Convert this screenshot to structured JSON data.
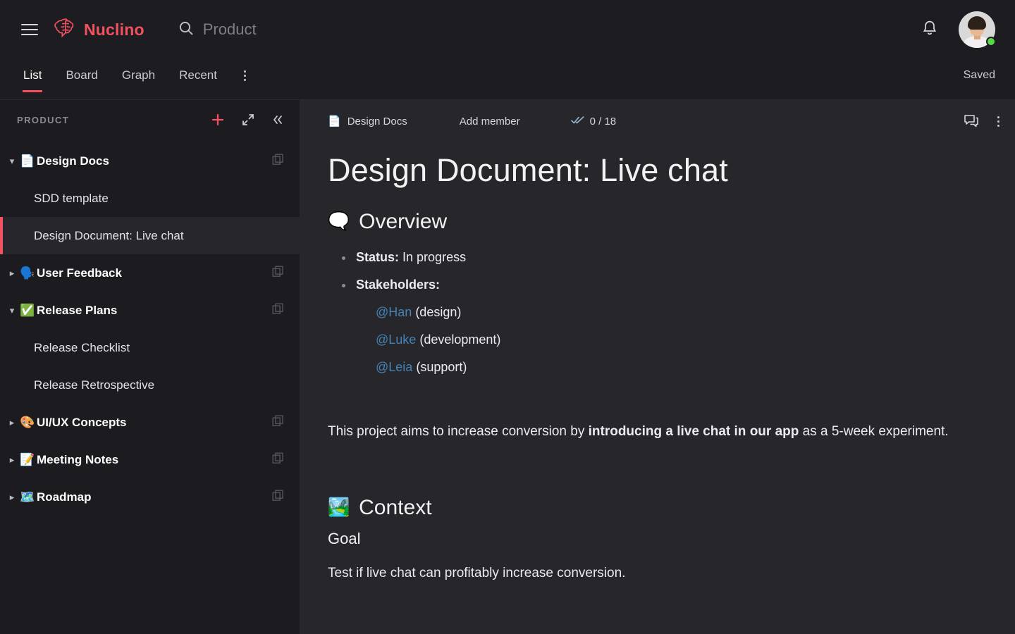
{
  "header": {
    "menu_icon": "hamburger-icon",
    "brand": "Nuclino",
    "brand_icon": "brain-speech-bubble-icon",
    "brand_color": "#f0525f",
    "search_icon": "search-icon",
    "search_value": "",
    "search_placeholder": "Product",
    "notifications_icon": "bell-icon",
    "avatar_icon": "user-avatar",
    "status": "online"
  },
  "tabbar": {
    "tabs": [
      {
        "label": "List",
        "active": true
      },
      {
        "label": "Board",
        "active": false
      },
      {
        "label": "Graph",
        "active": false
      },
      {
        "label": "Recent",
        "active": false
      }
    ],
    "more_icon": "vertical-dots-icon",
    "save_status": "Saved",
    "active_color": "#f0525f"
  },
  "sidebar": {
    "title": "PRODUCT",
    "actions": [
      {
        "name": "add-item-button",
        "icon": "plus-icon"
      },
      {
        "name": "expand-button",
        "icon": "expand-icon"
      },
      {
        "name": "collapse-sidebar-button",
        "icon": "double-chevron-left-icon"
      }
    ],
    "tree": [
      {
        "type": "cluster",
        "label": "Design Docs",
        "emoji": "📄",
        "expanded": true,
        "copy": true
      },
      {
        "type": "item",
        "label": "SDD template",
        "selected": false
      },
      {
        "type": "item",
        "label": "Design Document: Live chat",
        "selected": true
      },
      {
        "type": "cluster",
        "label": "User Feedback",
        "emoji": "🗣️",
        "expanded": false,
        "copy": true
      },
      {
        "type": "cluster",
        "label": "Release Plans",
        "emoji": "✅",
        "expanded": true,
        "copy": true
      },
      {
        "type": "item",
        "label": "Release Checklist",
        "selected": false
      },
      {
        "type": "item",
        "label": "Release Retrospective",
        "selected": false
      },
      {
        "type": "cluster",
        "label": "UI/UX Concepts",
        "emoji": "🎨",
        "expanded": false,
        "copy": true
      },
      {
        "type": "cluster",
        "label": "Meeting Notes",
        "emoji": "📝",
        "expanded": false,
        "copy": true
      },
      {
        "type": "cluster",
        "label": "Roadmap",
        "emoji": "🗺️",
        "expanded": false,
        "copy": true
      }
    ]
  },
  "doc_toolbar": {
    "breadcrumb_emoji": "📄",
    "breadcrumb": "Design Docs",
    "add_member": "Add member",
    "tasks_icon": "double-check-icon",
    "tasks_count": "0 / 18",
    "comments_icon": "comment-bubble-icon",
    "more_icon": "vertical-dots-icon"
  },
  "document": {
    "title": "Design Document: Live chat",
    "overview": {
      "emoji": "🗨️",
      "heading": "Overview",
      "status_label": "Status:",
      "status_value": "In progress",
      "stakeholders_label": "Stakeholders:",
      "stakeholders": [
        {
          "mention": "@Han",
          "role": "(design)"
        },
        {
          "mention": "@Luke",
          "role": "(development)"
        },
        {
          "mention": "@Leia",
          "role": "(support)"
        }
      ],
      "paragraph_pre": "This project aims to increase conversion by ",
      "paragraph_bold": "introducing a live chat in our app",
      "paragraph_post": " as a 5-week experiment."
    },
    "context": {
      "emoji": "🏞️",
      "heading": "Context",
      "goal_heading": "Goal",
      "goal_text": "Test if live chat can profitably increase conversion."
    }
  }
}
